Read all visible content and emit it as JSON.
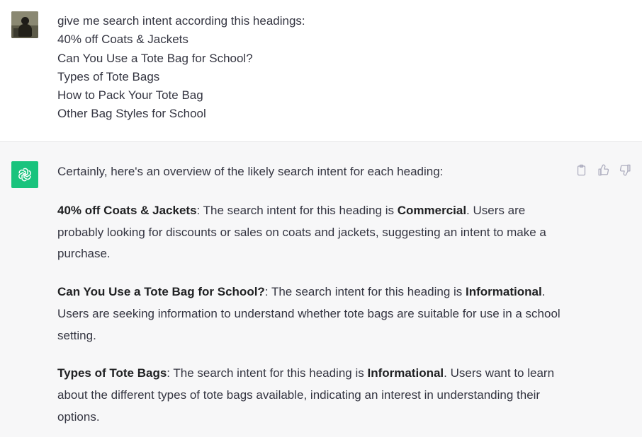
{
  "user_message": {
    "lines": [
      "give me search intent according this headings:",
      "40% off Coats & Jackets",
      "Can You Use a Tote Bag for School?",
      "Types of Tote Bags",
      "How to Pack Your Tote Bag",
      "Other Bag Styles for School"
    ]
  },
  "assistant_message": {
    "intro": "Certainly, here's an overview of the likely search intent for each heading:",
    "items": [
      {
        "heading": "40% off Coats & Jackets",
        "pre": ": The search intent for this heading is ",
        "intent": "Commercial",
        "post": ". Users are probably looking for discounts or sales on coats and jackets, suggesting an intent to make a purchase."
      },
      {
        "heading": "Can You Use a Tote Bag for School?",
        "pre": ": The search intent for this heading is ",
        "intent": "Informational",
        "post": ". Users are seeking information to understand whether tote bags are suitable for use in a school setting."
      },
      {
        "heading": "Types of Tote Bags",
        "pre": ": The search intent for this heading is ",
        "intent": "Informational",
        "post": ". Users want to learn about the different types of tote bags available, indicating an interest in understanding their options."
      }
    ]
  },
  "actions": {
    "copy_icon": "clipboard-icon",
    "like_icon": "thumbs-up-icon",
    "dislike_icon": "thumbs-down-icon"
  },
  "colors": {
    "assistant_avatar": "#19c37d",
    "assistant_bg": "#f7f7f8",
    "user_bg": "#ffffff"
  }
}
